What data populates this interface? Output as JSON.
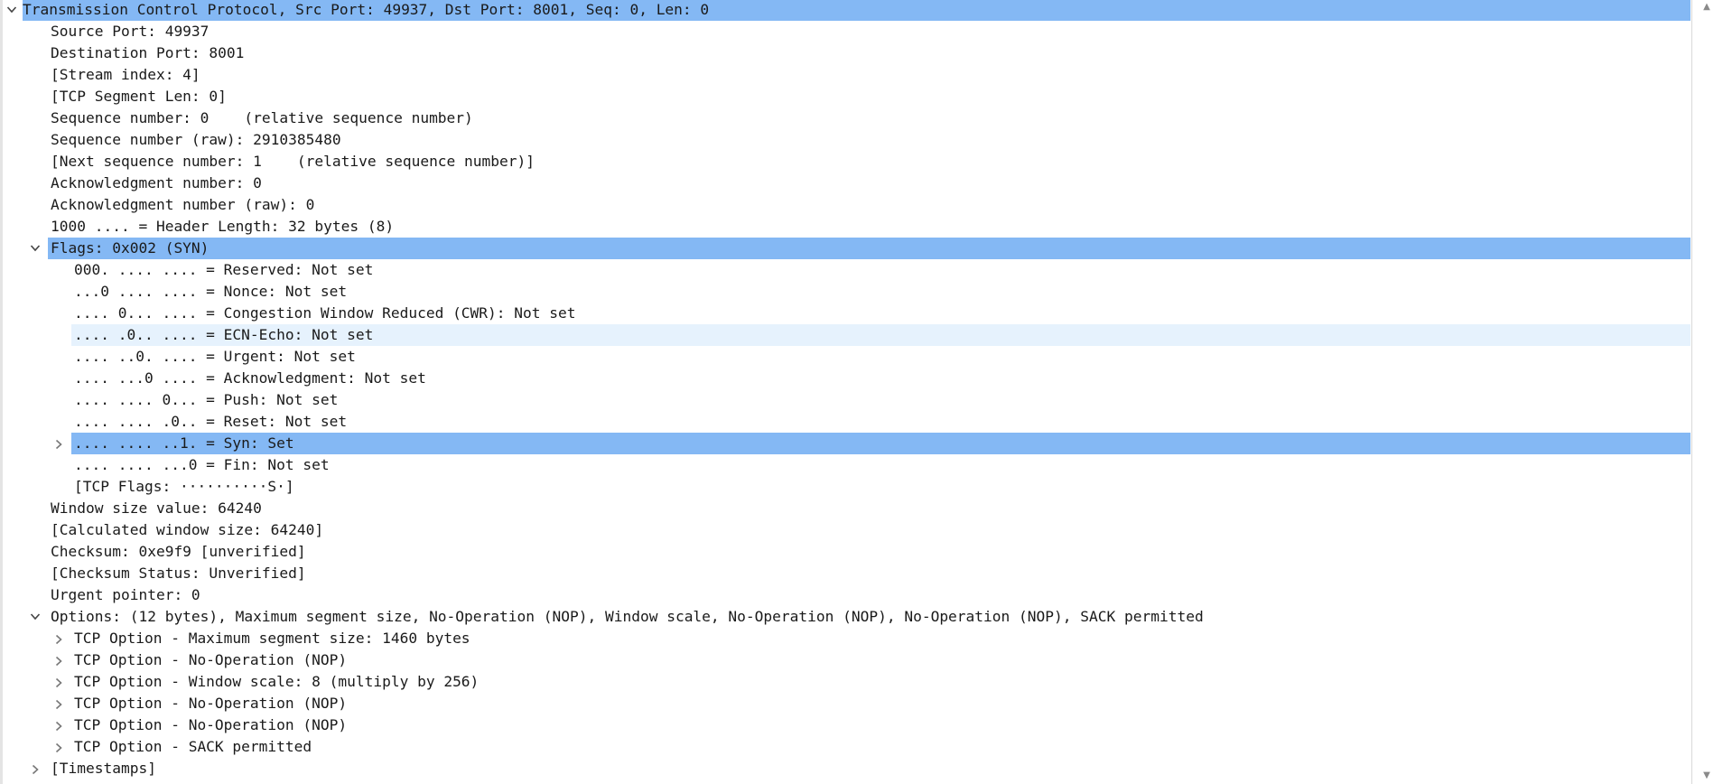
{
  "tree": {
    "rows": [
      {
        "text": "Transmission Control Protocol, Src Port: 49937, Dst Port: 8001, Seq: 0, Len: 0",
        "level": 0,
        "expander": "open",
        "state": "sel"
      },
      {
        "text": "Source Port: 49937",
        "level": 1,
        "expander": "none",
        "state": ""
      },
      {
        "text": "Destination Port: 8001",
        "level": 1,
        "expander": "none",
        "state": ""
      },
      {
        "text": "[Stream index: 4]",
        "level": 1,
        "expander": "none",
        "state": ""
      },
      {
        "text": "[TCP Segment Len: 0]",
        "level": 1,
        "expander": "none",
        "state": ""
      },
      {
        "text": "Sequence number: 0    (relative sequence number)",
        "level": 1,
        "expander": "none",
        "state": ""
      },
      {
        "text": "Sequence number (raw): 2910385480",
        "level": 1,
        "expander": "none",
        "state": ""
      },
      {
        "text": "[Next sequence number: 1    (relative sequence number)]",
        "level": 1,
        "expander": "none",
        "state": ""
      },
      {
        "text": "Acknowledgment number: 0",
        "level": 1,
        "expander": "none",
        "state": ""
      },
      {
        "text": "Acknowledgment number (raw): 0",
        "level": 1,
        "expander": "none",
        "state": ""
      },
      {
        "text": "1000 .... = Header Length: 32 bytes (8)",
        "level": 1,
        "expander": "none",
        "state": ""
      },
      {
        "text": "Flags: 0x002 (SYN)",
        "level": 1,
        "expander": "open",
        "state": "sel"
      },
      {
        "text": "000. .... .... = Reserved: Not set",
        "level": 2,
        "expander": "none",
        "state": ""
      },
      {
        "text": "...0 .... .... = Nonce: Not set",
        "level": 2,
        "expander": "none",
        "state": ""
      },
      {
        "text": ".... 0... .... = Congestion Window Reduced (CWR): Not set",
        "level": 2,
        "expander": "none",
        "state": ""
      },
      {
        "text": ".... .0.. .... = ECN-Echo: Not set",
        "level": 2,
        "expander": "none",
        "state": "hover"
      },
      {
        "text": ".... ..0. .... = Urgent: Not set",
        "level": 2,
        "expander": "none",
        "state": ""
      },
      {
        "text": ".... ...0 .... = Acknowledgment: Not set",
        "level": 2,
        "expander": "none",
        "state": ""
      },
      {
        "text": ".... .... 0... = Push: Not set",
        "level": 2,
        "expander": "none",
        "state": ""
      },
      {
        "text": ".... .... .0.. = Reset: Not set",
        "level": 2,
        "expander": "none",
        "state": ""
      },
      {
        "text": ".... .... ..1. = Syn: Set",
        "level": 2,
        "expander": "closed",
        "state": "sel"
      },
      {
        "text": ".... .... ...0 = Fin: Not set",
        "level": 2,
        "expander": "none",
        "state": ""
      },
      {
        "text": "[TCP Flags: ··········S·]",
        "level": 2,
        "expander": "none",
        "state": ""
      },
      {
        "text": "Window size value: 64240",
        "level": 1,
        "expander": "none",
        "state": ""
      },
      {
        "text": "[Calculated window size: 64240]",
        "level": 1,
        "expander": "none",
        "state": ""
      },
      {
        "text": "Checksum: 0xe9f9 [unverified]",
        "level": 1,
        "expander": "none",
        "state": ""
      },
      {
        "text": "[Checksum Status: Unverified]",
        "level": 1,
        "expander": "none",
        "state": ""
      },
      {
        "text": "Urgent pointer: 0",
        "level": 1,
        "expander": "none",
        "state": ""
      },
      {
        "text": "Options: (12 bytes), Maximum segment size, No-Operation (NOP), Window scale, No-Operation (NOP), No-Operation (NOP), SACK permitted",
        "level": 1,
        "expander": "open",
        "state": ""
      },
      {
        "text": "TCP Option - Maximum segment size: 1460 bytes",
        "level": 2,
        "expander": "closed",
        "state": ""
      },
      {
        "text": "TCP Option - No-Operation (NOP)",
        "level": 2,
        "expander": "closed",
        "state": ""
      },
      {
        "text": "TCP Option - Window scale: 8 (multiply by 256)",
        "level": 2,
        "expander": "closed",
        "state": ""
      },
      {
        "text": "TCP Option - No-Operation (NOP)",
        "level": 2,
        "expander": "closed",
        "state": ""
      },
      {
        "text": "TCP Option - No-Operation (NOP)",
        "level": 2,
        "expander": "closed",
        "state": ""
      },
      {
        "text": "TCP Option - SACK permitted",
        "level": 2,
        "expander": "closed",
        "state": ""
      },
      {
        "text": "[Timestamps]",
        "level": 1,
        "expander": "closed",
        "state": ""
      }
    ]
  },
  "colors": {
    "selection": "#84b8f4",
    "hover": "#e6f2fd",
    "text": "#1a1a1a"
  }
}
